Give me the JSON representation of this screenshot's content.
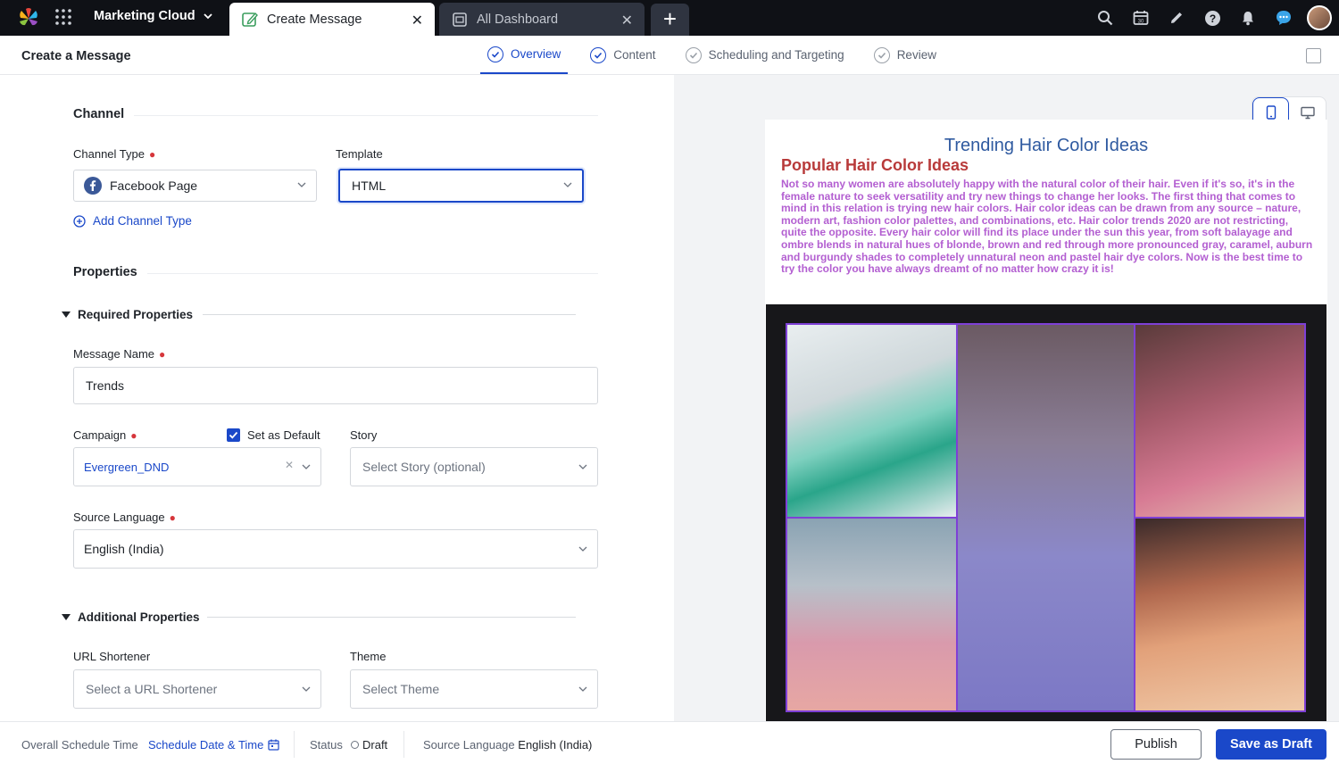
{
  "app": {
    "name": "Marketing Cloud"
  },
  "tabs": [
    {
      "label": "Create Message",
      "active": true
    },
    {
      "label": "All Dashboard",
      "active": false
    }
  ],
  "topbar_icons": [
    "search-icon",
    "calendar-icon",
    "pencil-icon",
    "help-icon",
    "bell-icon",
    "chat-icon",
    "user-avatar"
  ],
  "header": {
    "title": "Create a Message"
  },
  "steps": [
    {
      "label": "Overview",
      "state": "active"
    },
    {
      "label": "Content",
      "state": "done"
    },
    {
      "label": "Scheduling and Targeting",
      "state": "todo"
    },
    {
      "label": "Review",
      "state": "todo"
    }
  ],
  "channel": {
    "section_title": "Channel",
    "type_label": "Channel Type",
    "type_value": "Facebook Page",
    "template_label": "Template",
    "template_value": "HTML",
    "add_link": "Add Channel Type"
  },
  "properties": {
    "section_title": "Properties",
    "required_title": "Required Properties",
    "message_name_label": "Message Name",
    "message_name_value": "Trends",
    "campaign_label": "Campaign",
    "campaign_value": "Evergreen_DND",
    "set_default_label": "Set as Default",
    "set_default_checked": true,
    "story_label": "Story",
    "story_placeholder": "Select Story (optional)",
    "source_language_label": "Source Language",
    "source_language_value": "English (India)",
    "additional_title": "Additional Properties",
    "url_shortener_label": "URL Shortener",
    "url_shortener_placeholder": "Select a URL Shortener",
    "theme_label": "Theme",
    "theme_placeholder": "Select Theme"
  },
  "preview": {
    "title": "Trending Hair Color Ideas",
    "heading": "Popular Hair Color Ideas",
    "body": "Not so many women are absolutely happy with the natural color of their hair. Even if it's so, it's in the female nature to seek versatility and try new things to change her looks. The first thing that comes to mind in this relation is trying new hair colors. Hair color ideas can be drawn from any source – nature, modern art, fashion color palettes, and combinations, etc. Hair color trends 2020 are not restricting, quite the opposite. Every hair color will find its place under the sun this year, from soft balayage and ombre blends in natural hues of blonde, brown and red through more pronounced gray, caramel, auburn and burgundy shades to completely unnatural neon and pastel hair dye colors. Now is the best time to try the color you have always dreamt of no matter how crazy it is!",
    "device": "mobile"
  },
  "footer": {
    "schedule_label": "Overall Schedule Time",
    "schedule_link": "Schedule Date & Time",
    "status_label": "Status",
    "status_value": "Draft",
    "source_language_label": "Source Language",
    "source_language_value": "English (India)",
    "publish_label": "Publish",
    "save_label": "Save as Draft"
  },
  "colors": {
    "accent": "#1a48c9",
    "topbar": "#0f1116",
    "required": "#d6363b",
    "preview_body": "#b35fd1",
    "preview_heading": "#b83a3a",
    "preview_title": "#2f5aa0"
  }
}
